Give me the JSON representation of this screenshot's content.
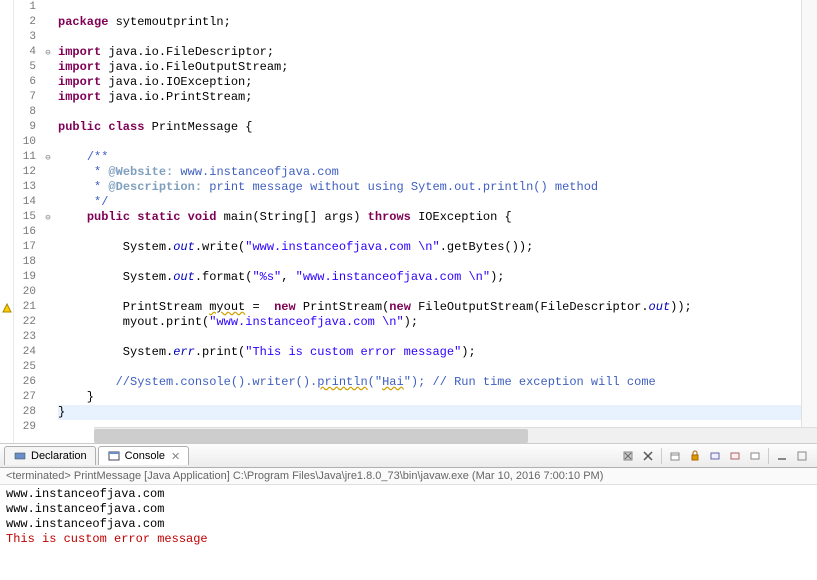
{
  "code": {
    "lines": [
      {
        "n": 1,
        "tokens": []
      },
      {
        "n": 2,
        "tokens": [
          {
            "t": "package ",
            "c": "kw"
          },
          {
            "t": "sytemoutprintln;"
          }
        ]
      },
      {
        "n": 3,
        "tokens": []
      },
      {
        "n": 4,
        "fold": "⊖",
        "tokens": [
          {
            "t": "import ",
            "c": "kw"
          },
          {
            "t": "java.io.FileDescriptor;"
          }
        ]
      },
      {
        "n": 5,
        "tokens": [
          {
            "t": "import ",
            "c": "kw"
          },
          {
            "t": "java.io.FileOutputStream;"
          }
        ]
      },
      {
        "n": 6,
        "tokens": [
          {
            "t": "import ",
            "c": "kw"
          },
          {
            "t": "java.io.IOException;"
          }
        ]
      },
      {
        "n": 7,
        "tokens": [
          {
            "t": "import ",
            "c": "kw"
          },
          {
            "t": "java.io.PrintStream;"
          }
        ]
      },
      {
        "n": 8,
        "tokens": []
      },
      {
        "n": 9,
        "tokens": [
          {
            "t": "public class ",
            "c": "kw"
          },
          {
            "t": "PrintMessage {"
          }
        ]
      },
      {
        "n": 10,
        "tokens": []
      },
      {
        "n": 11,
        "fold": "⊖",
        "tokens": [
          {
            "t": "    "
          },
          {
            "t": "/**",
            "c": "com"
          }
        ]
      },
      {
        "n": 12,
        "tokens": [
          {
            "t": "     * ",
            "c": "com"
          },
          {
            "t": "@Website:",
            "c": "tag"
          },
          {
            "t": " www.instanceofjava.com",
            "c": "com"
          }
        ]
      },
      {
        "n": 13,
        "tokens": [
          {
            "t": "     * ",
            "c": "com"
          },
          {
            "t": "@Description:",
            "c": "tag"
          },
          {
            "t": " print message without using Sytem.out.println() method",
            "c": "com"
          }
        ]
      },
      {
        "n": 14,
        "tokens": [
          {
            "t": "     */",
            "c": "com"
          }
        ]
      },
      {
        "n": 15,
        "fold": "⊖",
        "tokens": [
          {
            "t": "    "
          },
          {
            "t": "public static void ",
            "c": "kw"
          },
          {
            "t": "main(String[] args) "
          },
          {
            "t": "throws ",
            "c": "kw"
          },
          {
            "t": "IOException {"
          }
        ]
      },
      {
        "n": 16,
        "tokens": []
      },
      {
        "n": 17,
        "tokens": [
          {
            "t": "         System."
          },
          {
            "t": "out",
            "c": "fld"
          },
          {
            "t": ".write("
          },
          {
            "t": "\"www.instanceofjava.com \\n\"",
            "c": "str"
          },
          {
            "t": ".getBytes());"
          }
        ]
      },
      {
        "n": 18,
        "tokens": []
      },
      {
        "n": 19,
        "tokens": [
          {
            "t": "         System."
          },
          {
            "t": "out",
            "c": "fld"
          },
          {
            "t": ".format("
          },
          {
            "t": "\"%s\"",
            "c": "str"
          },
          {
            "t": ", "
          },
          {
            "t": "\"www.instanceofjava.com \\n\"",
            "c": "str"
          },
          {
            "t": ");"
          }
        ]
      },
      {
        "n": 20,
        "tokens": []
      },
      {
        "n": 21,
        "marker": "warn",
        "tokens": [
          {
            "t": "         PrintStream "
          },
          {
            "t": "myout",
            "c": "err-underline"
          },
          {
            "t": " =  "
          },
          {
            "t": "new ",
            "c": "kw"
          },
          {
            "t": "PrintStream("
          },
          {
            "t": "new ",
            "c": "kw"
          },
          {
            "t": "FileOutputStream(FileDescriptor."
          },
          {
            "t": "out",
            "c": "fld"
          },
          {
            "t": "));"
          }
        ]
      },
      {
        "n": 22,
        "tokens": [
          {
            "t": "         myout.print("
          },
          {
            "t": "\"www.instanceofjava.com \\n\"",
            "c": "str"
          },
          {
            "t": ");"
          }
        ]
      },
      {
        "n": 23,
        "tokens": []
      },
      {
        "n": 24,
        "tokens": [
          {
            "t": "         System."
          },
          {
            "t": "err",
            "c": "fld"
          },
          {
            "t": ".print("
          },
          {
            "t": "\"This is custom error message\"",
            "c": "str"
          },
          {
            "t": ");"
          }
        ]
      },
      {
        "n": 25,
        "tokens": []
      },
      {
        "n": 26,
        "tokens": [
          {
            "t": "        "
          },
          {
            "t": "//System.console().writer().",
            "c": "com"
          },
          {
            "t": "println",
            "c": "com err-underline"
          },
          {
            "t": "(\"",
            "c": "com"
          },
          {
            "t": "Hai",
            "c": "com err-underline"
          },
          {
            "t": "\"); // Run time exception will come",
            "c": "com"
          }
        ]
      },
      {
        "n": 27,
        "tokens": [
          {
            "t": "    }"
          }
        ]
      },
      {
        "n": 28,
        "hl": true,
        "tokens": [
          {
            "t": "}"
          }
        ]
      },
      {
        "n": 29,
        "tokens": []
      }
    ]
  },
  "panel": {
    "tabs": {
      "declaration": "Declaration",
      "console": "Console"
    },
    "header": "<terminated> PrintMessage [Java Application] C:\\Program Files\\Java\\jre1.8.0_73\\bin\\javaw.exe (Mar 10, 2016 7:00:10 PM)",
    "output": [
      {
        "text": "www.instanceofjava.com",
        "err": false
      },
      {
        "text": "www.instanceofjava.com",
        "err": false
      },
      {
        "text": "www.instanceofjava.com",
        "err": false
      },
      {
        "text": "This is custom error message",
        "err": true
      }
    ]
  },
  "icons": {
    "declaration": "◈",
    "console": "▣"
  }
}
